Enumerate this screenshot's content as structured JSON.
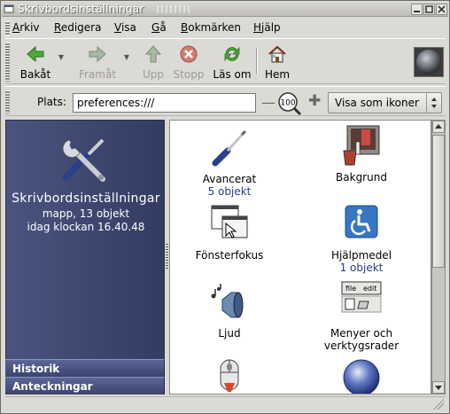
{
  "window": {
    "title": "Skrivbordsinställningar"
  },
  "menubar": {
    "items": [
      {
        "pre": "",
        "ul": "A",
        "post": "rkiv"
      },
      {
        "pre": "",
        "ul": "R",
        "post": "edigera"
      },
      {
        "pre": "",
        "ul": "V",
        "post": "isa"
      },
      {
        "pre": "",
        "ul": "G",
        "post": "å"
      },
      {
        "pre": "",
        "ul": "B",
        "post": "okmärken"
      },
      {
        "pre": "",
        "ul": "H",
        "post": "jälp"
      }
    ]
  },
  "toolbar": {
    "back": "Bakåt",
    "forward": "Framåt",
    "up": "Upp",
    "stop": "Stopp",
    "reload": "Läs om",
    "home": "Hem"
  },
  "location": {
    "label": "Plats:",
    "value": "preferences:///",
    "zoom": "100",
    "view_mode": "Visa som ikoner"
  },
  "sidebar": {
    "name": "Skrivbordsinställningar",
    "info": "mapp, 13 objekt",
    "date": "idag klockan 16.40.48",
    "tabs": [
      "Historik",
      "Anteckningar"
    ]
  },
  "items": [
    {
      "label": "Avancerat",
      "sub": "5 objekt",
      "icon": "screwdriver-icon"
    },
    {
      "label": "Bakgrund",
      "sub": "",
      "icon": "paint-bucket-icon"
    },
    {
      "label": "Fönsterfokus",
      "sub": "",
      "icon": "window-focus-icon"
    },
    {
      "label": "Hjälpmedel",
      "sub": "1 objekt",
      "icon": "accessibility-icon"
    },
    {
      "label": "Ljud",
      "sub": "",
      "icon": "speaker-icon"
    },
    {
      "label": "Menyer och",
      "label2": "verktygsrader",
      "sub": "",
      "icon": "menus-toolbars-icon"
    },
    {
      "label": "",
      "sub": "",
      "icon": "mouse-icon"
    },
    {
      "label": "",
      "sub": "",
      "icon": "globe-icon"
    }
  ],
  "menus_icon_text": {
    "file": "file",
    "edit": "edit"
  }
}
